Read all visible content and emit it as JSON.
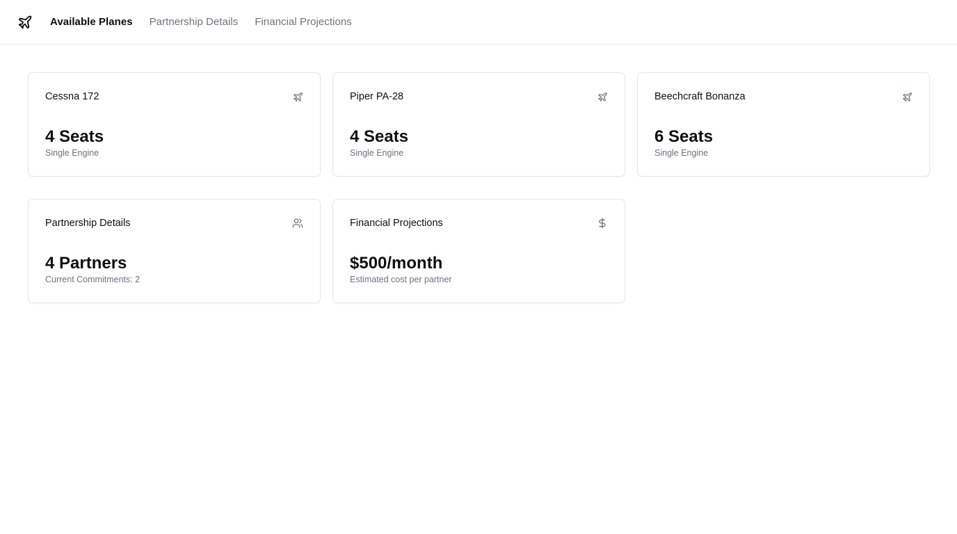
{
  "nav": {
    "logo_icon": "plane-icon",
    "links": [
      {
        "label": "Available Planes",
        "active": true
      },
      {
        "label": "Partnership Details",
        "active": false
      },
      {
        "label": "Financial Projections",
        "active": false
      }
    ]
  },
  "planes": [
    {
      "name": "Cessna 172",
      "seats": "4 Seats",
      "engine": "Single Engine",
      "icon": "plane-icon"
    },
    {
      "name": "Piper PA-28",
      "seats": "4 Seats",
      "engine": "Single Engine",
      "icon": "plane-icon"
    },
    {
      "name": "Beechcraft Bonanza",
      "seats": "6 Seats",
      "engine": "Single Engine",
      "icon": "plane-icon"
    }
  ],
  "partnership": {
    "title": "Partnership Details",
    "value": "4 Partners",
    "sub": "Current Commitments: 2",
    "icon": "users-icon"
  },
  "financial": {
    "title": "Financial Projections",
    "value": "$500/month",
    "sub": "Estimated cost per partner",
    "icon": "dollar-icon"
  },
  "colors": {
    "text": "#0f0f10",
    "muted": "#6b7280",
    "border": "#e5e7eb"
  }
}
